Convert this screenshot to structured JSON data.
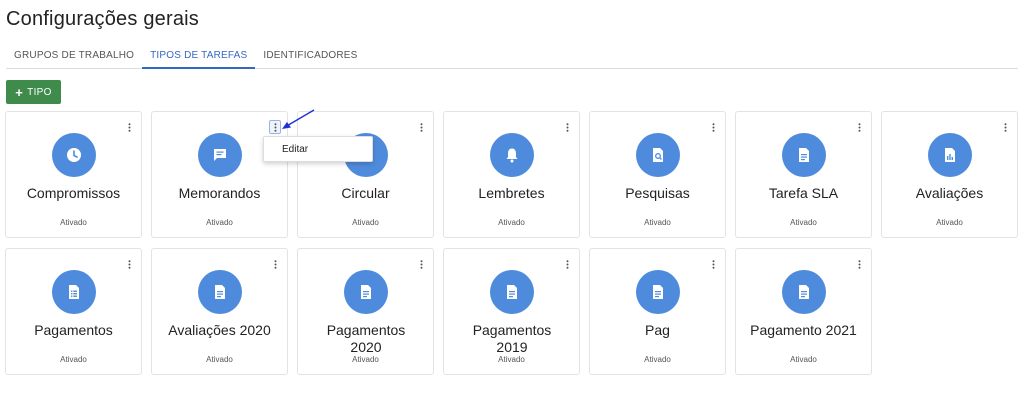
{
  "header": {
    "title": "Configurações gerais"
  },
  "tabs": [
    {
      "label": "GRUPOS DE TRABALHO",
      "active": false
    },
    {
      "label": "TIPOS DE TAREFAS",
      "active": true
    },
    {
      "label": "IDENTIFICADORES",
      "active": false
    }
  ],
  "toolbar": {
    "add_icon": "+",
    "add_label": "TIPO"
  },
  "cards": [
    {
      "name": "Compromissos",
      "status": "Ativado",
      "icon": "clock-icon"
    },
    {
      "name": "Memorandos",
      "status": "Ativado",
      "icon": "message-icon"
    },
    {
      "name": "Circular",
      "status": "Ativado",
      "icon": "circle-icon"
    },
    {
      "name": "Lembretes",
      "status": "Ativado",
      "icon": "bell-icon"
    },
    {
      "name": "Pesquisas",
      "status": "Ativado",
      "icon": "search-document-icon"
    },
    {
      "name": "Tarefa SLA",
      "status": "Ativado",
      "icon": "document-icon"
    },
    {
      "name": "Avaliações",
      "status": "Ativado",
      "icon": "chart-document-icon"
    },
    {
      "name": "Pagamentos",
      "status": "Ativado",
      "icon": "list-document-icon"
    },
    {
      "name": "Avaliações 2020",
      "status": "Ativado",
      "icon": "document-icon"
    },
    {
      "name": "Pagamentos 2020",
      "status": "Ativado",
      "icon": "document-icon"
    },
    {
      "name": "Pagamentos 2019",
      "status": "Ativado",
      "icon": "document-icon"
    },
    {
      "name": "Pag",
      "status": "Ativado",
      "icon": "document-icon"
    },
    {
      "name": "Pagamento 2021",
      "status": "Ativado",
      "icon": "document-icon"
    }
  ],
  "context_menu": {
    "items": [
      {
        "label": "Editar"
      }
    ]
  },
  "colors": {
    "accent": "#3568c4",
    "primary_button": "#3e8b4b",
    "icon_circle": "#4f8bdc",
    "annotation_arrow": "#1f2fd6"
  }
}
